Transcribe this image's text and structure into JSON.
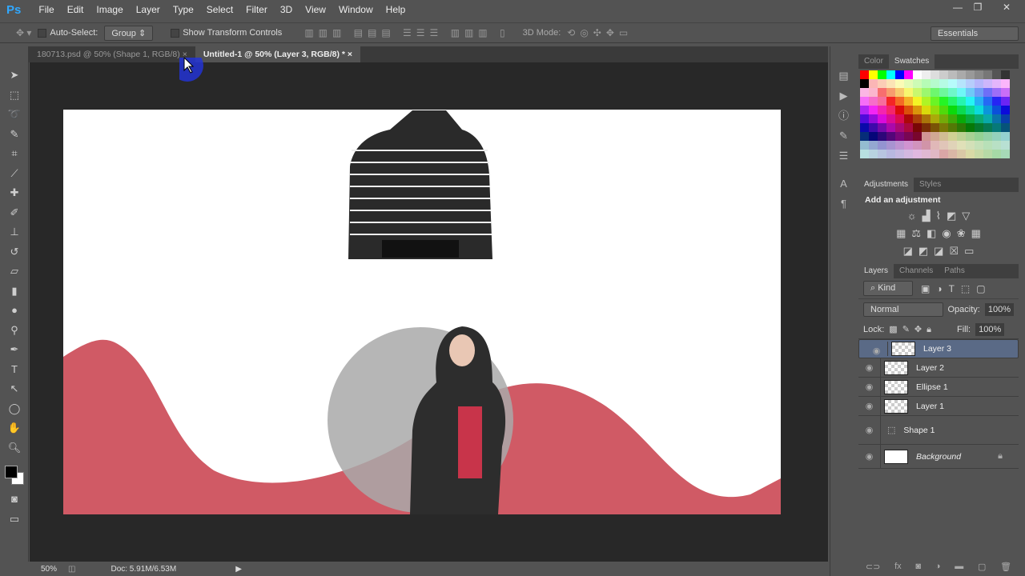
{
  "app": {
    "logo": "Ps"
  },
  "menu": [
    "File",
    "Edit",
    "Image",
    "Layer",
    "Type",
    "Select",
    "Filter",
    "3D",
    "View",
    "Window",
    "Help"
  ],
  "window_controls": [
    "—",
    "❐",
    "✕"
  ],
  "options": {
    "auto_select_label": "Auto-Select:",
    "auto_select_value": "Group",
    "transform_label": "Show Transform Controls",
    "mode_label": "3D Mode:",
    "workspace": "Essentials"
  },
  "tabs": [
    {
      "label": "180713.psd @ 50% (Shape 1, RGB/8)",
      "close": "×"
    },
    {
      "label": "Untitled-1 @ 50% (Layer 3, RGB/8) *",
      "close": "×"
    }
  ],
  "status": {
    "zoom": "50%",
    "doc": "Doc: 5.91M/6.53M"
  },
  "colors": {
    "pink": "#d05a65",
    "circle": "#a9a9a9"
  },
  "panels": {
    "color_tabs": [
      "Color",
      "Swatches"
    ],
    "adj_tabs": [
      "Adjustments",
      "Styles"
    ],
    "adj_title": "Add an adjustment",
    "layer_tabs": [
      "Layers",
      "Channels",
      "Paths"
    ],
    "kind": "Kind",
    "blend": "Normal",
    "opacity_label": "Opacity:",
    "opacity": "100%",
    "lock_label": "Lock:",
    "fill_label": "Fill:",
    "fill": "100%",
    "layers": [
      {
        "name": "Layer 3",
        "selected": true
      },
      {
        "name": "Layer 2"
      },
      {
        "name": "Ellipse 1"
      },
      {
        "name": "Layer 1"
      },
      {
        "name": "Shape 1"
      },
      {
        "name": "Background"
      }
    ]
  }
}
